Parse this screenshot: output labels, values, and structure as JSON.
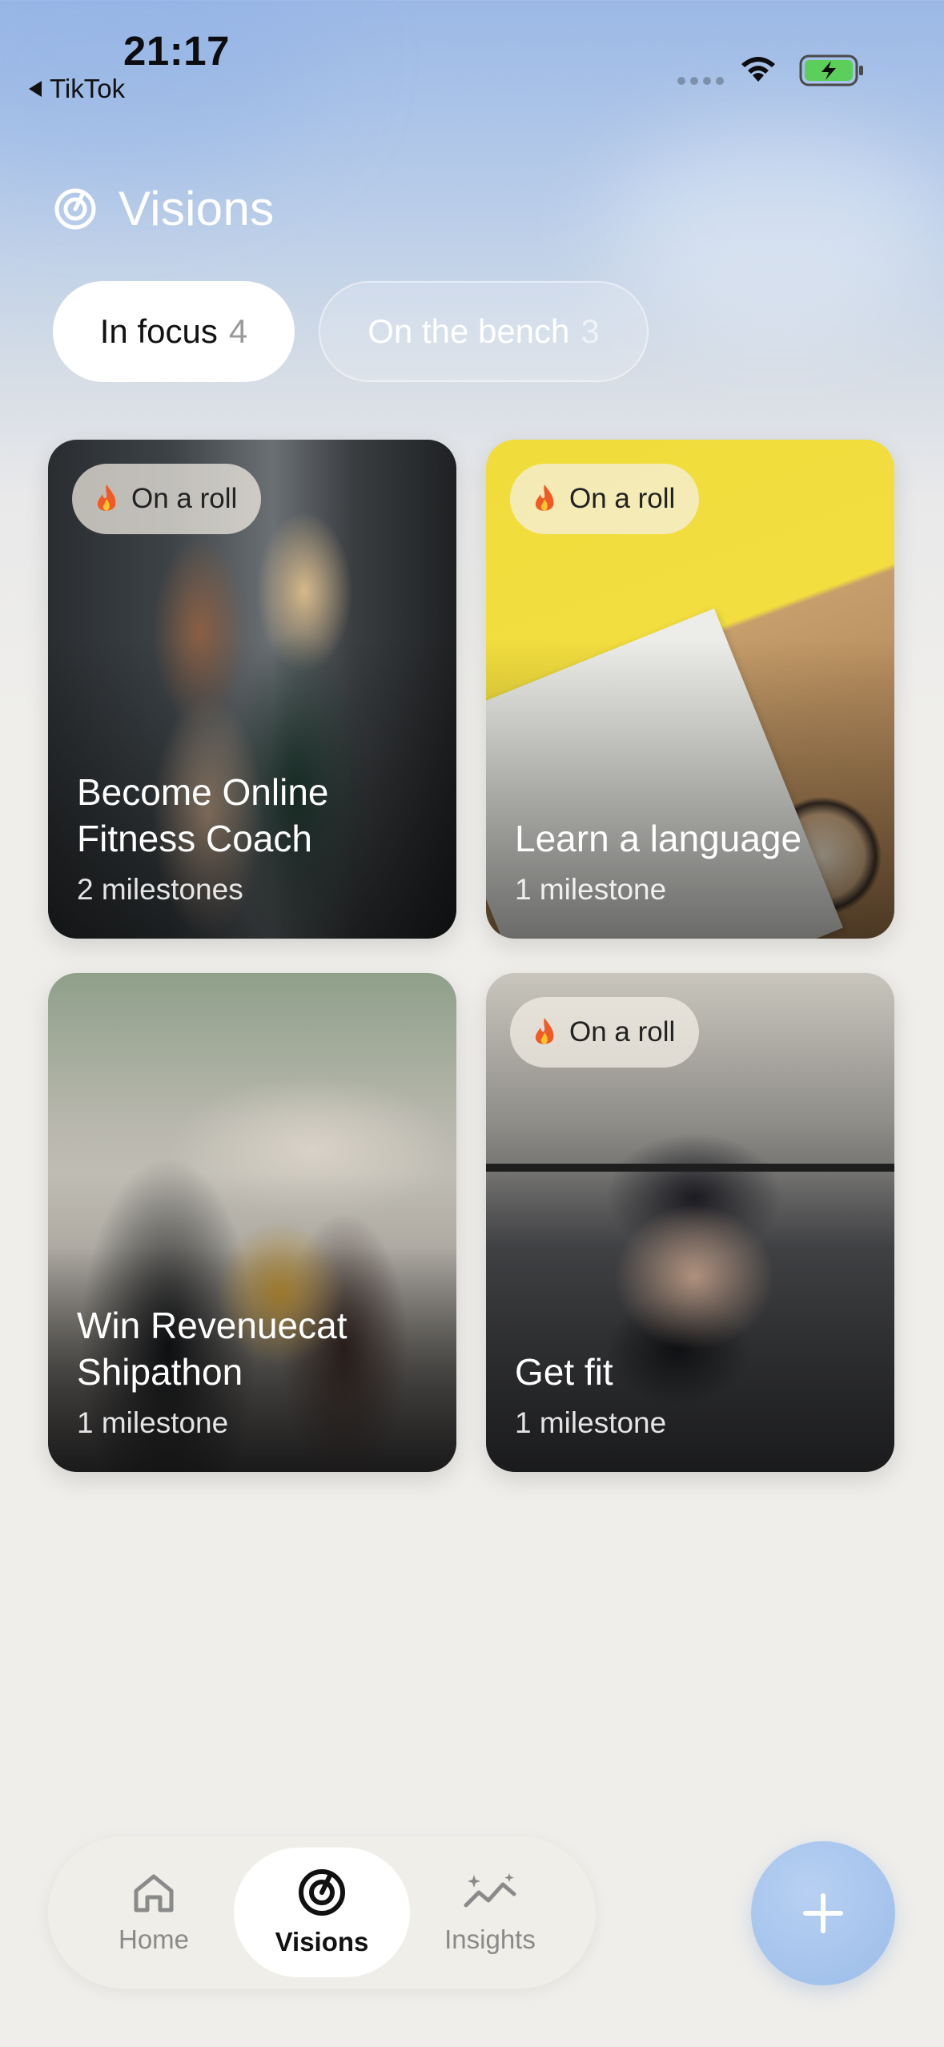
{
  "status_bar": {
    "time": "21:17",
    "back_app": "TikTok"
  },
  "header": {
    "title": "Visions",
    "icon": "target-icon"
  },
  "tabs": [
    {
      "label": "In focus",
      "count": "4",
      "active": true
    },
    {
      "label": "On the bench",
      "count": "3",
      "active": false
    }
  ],
  "cards": [
    {
      "title": "Become Online Fitness Coach",
      "milestones": "2 milestones",
      "badge": "On a roll"
    },
    {
      "title": "Learn a language",
      "milestones": "1 milestone",
      "badge": "On a roll"
    },
    {
      "title": "Win Revenuecat Shipathon",
      "milestones": "1 milestone",
      "badge": ""
    },
    {
      "title": "Get fit",
      "milestones": "1 milestone",
      "badge": "On a roll"
    }
  ],
  "nav": [
    {
      "label": "Home",
      "icon": "home-icon",
      "active": false
    },
    {
      "label": "Visions",
      "icon": "target-icon",
      "active": true
    },
    {
      "label": "Insights",
      "icon": "sparkle-chart-icon",
      "active": false
    }
  ],
  "fab": {
    "icon": "plus-icon"
  },
  "colors": {
    "accent": "#9bbde9",
    "header_bg": "#9bb8e6",
    "page_bg": "#efeeeb"
  }
}
